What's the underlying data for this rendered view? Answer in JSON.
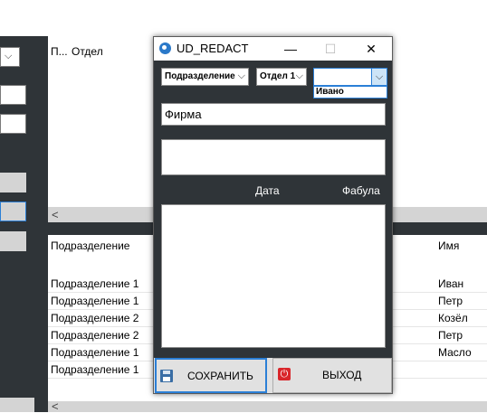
{
  "background": {
    "grid1": {
      "columns": [
        "П...",
        "Отдел"
      ]
    },
    "grid2": {
      "columns": [
        "Подразделение",
        "Имя"
      ],
      "rows": [
        {
          "dept": "Подразделение 1",
          "name": "Иван"
        },
        {
          "dept": "Подразделение 1",
          "name": "Петр"
        },
        {
          "dept": "Подразделение 2",
          "name": "Козёл"
        },
        {
          "dept": "Подразделение 2",
          "name": "Петр"
        },
        {
          "dept": "Подразделение 1",
          "name": "Масло"
        },
        {
          "dept": "Подразделение 1",
          "name": ""
        }
      ]
    },
    "scroll_left_arrow": "<"
  },
  "dialog": {
    "title": "UD_REDACT",
    "controls": {
      "minimize": "—",
      "maximize": "☐",
      "close": "✕"
    },
    "combo_division": {
      "value": "Подразделение",
      "chevron": "⌵"
    },
    "combo_department": {
      "value": "Отдел 1",
      "chevron": "⌵"
    },
    "combo_employee": {
      "value": "",
      "chevron": "⌵",
      "dropdown_options": [
        "Ивано"
      ]
    },
    "firm_field": {
      "value": "Фирма"
    },
    "second_field": {
      "value": ""
    },
    "labels": {
      "date": "Дата",
      "fabula": "Фабула"
    },
    "memo_field": {
      "value": ""
    },
    "save_button": {
      "label": "СОХРАНИТЬ"
    },
    "exit_button": {
      "label": "ВЫХОД"
    }
  },
  "colors": {
    "panel_dark": "#2f3438",
    "accent_blue": "#2b7fd6",
    "exit_red": "#d9262b"
  },
  "icons": [
    "app-icon",
    "minimize-icon",
    "maximize-icon",
    "close-icon",
    "chevron-down-icon",
    "floppy-disk-icon",
    "power-icon"
  ]
}
